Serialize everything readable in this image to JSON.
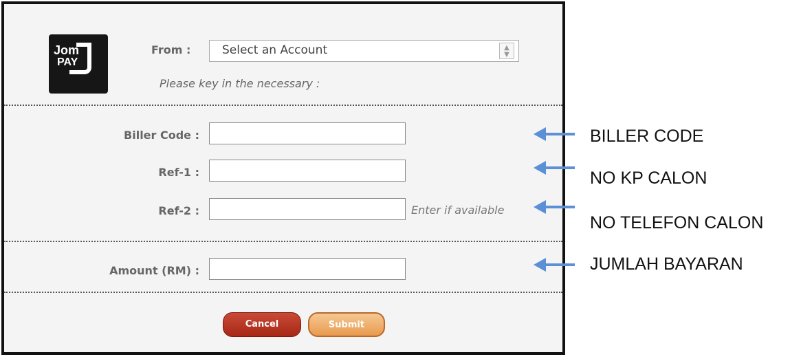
{
  "logo": {
    "line1": "Jom",
    "line2": "PAY"
  },
  "form": {
    "from_label": "From :",
    "account_select": {
      "value": "Select an Account"
    },
    "instruction": "Please key in the necessary :",
    "biller_code_label": "Biller Code :",
    "ref1_label": "Ref-1 :",
    "ref2_label": "Ref-2 :",
    "ref2_hint": "Enter if available",
    "amount_label": "Amount (RM) :",
    "cancel_label": "Cancel",
    "submit_label": "Submit"
  },
  "annotations": [
    {
      "text": "BILLER CODE"
    },
    {
      "text": "NO KP CALON"
    },
    {
      "text": "NO TELEFON CALON"
    },
    {
      "text": "JUMLAH BAYARAN"
    }
  ],
  "colors": {
    "arrow": "#5b8fd6",
    "cancel": "#b3311d",
    "submit": "#f0b070"
  }
}
